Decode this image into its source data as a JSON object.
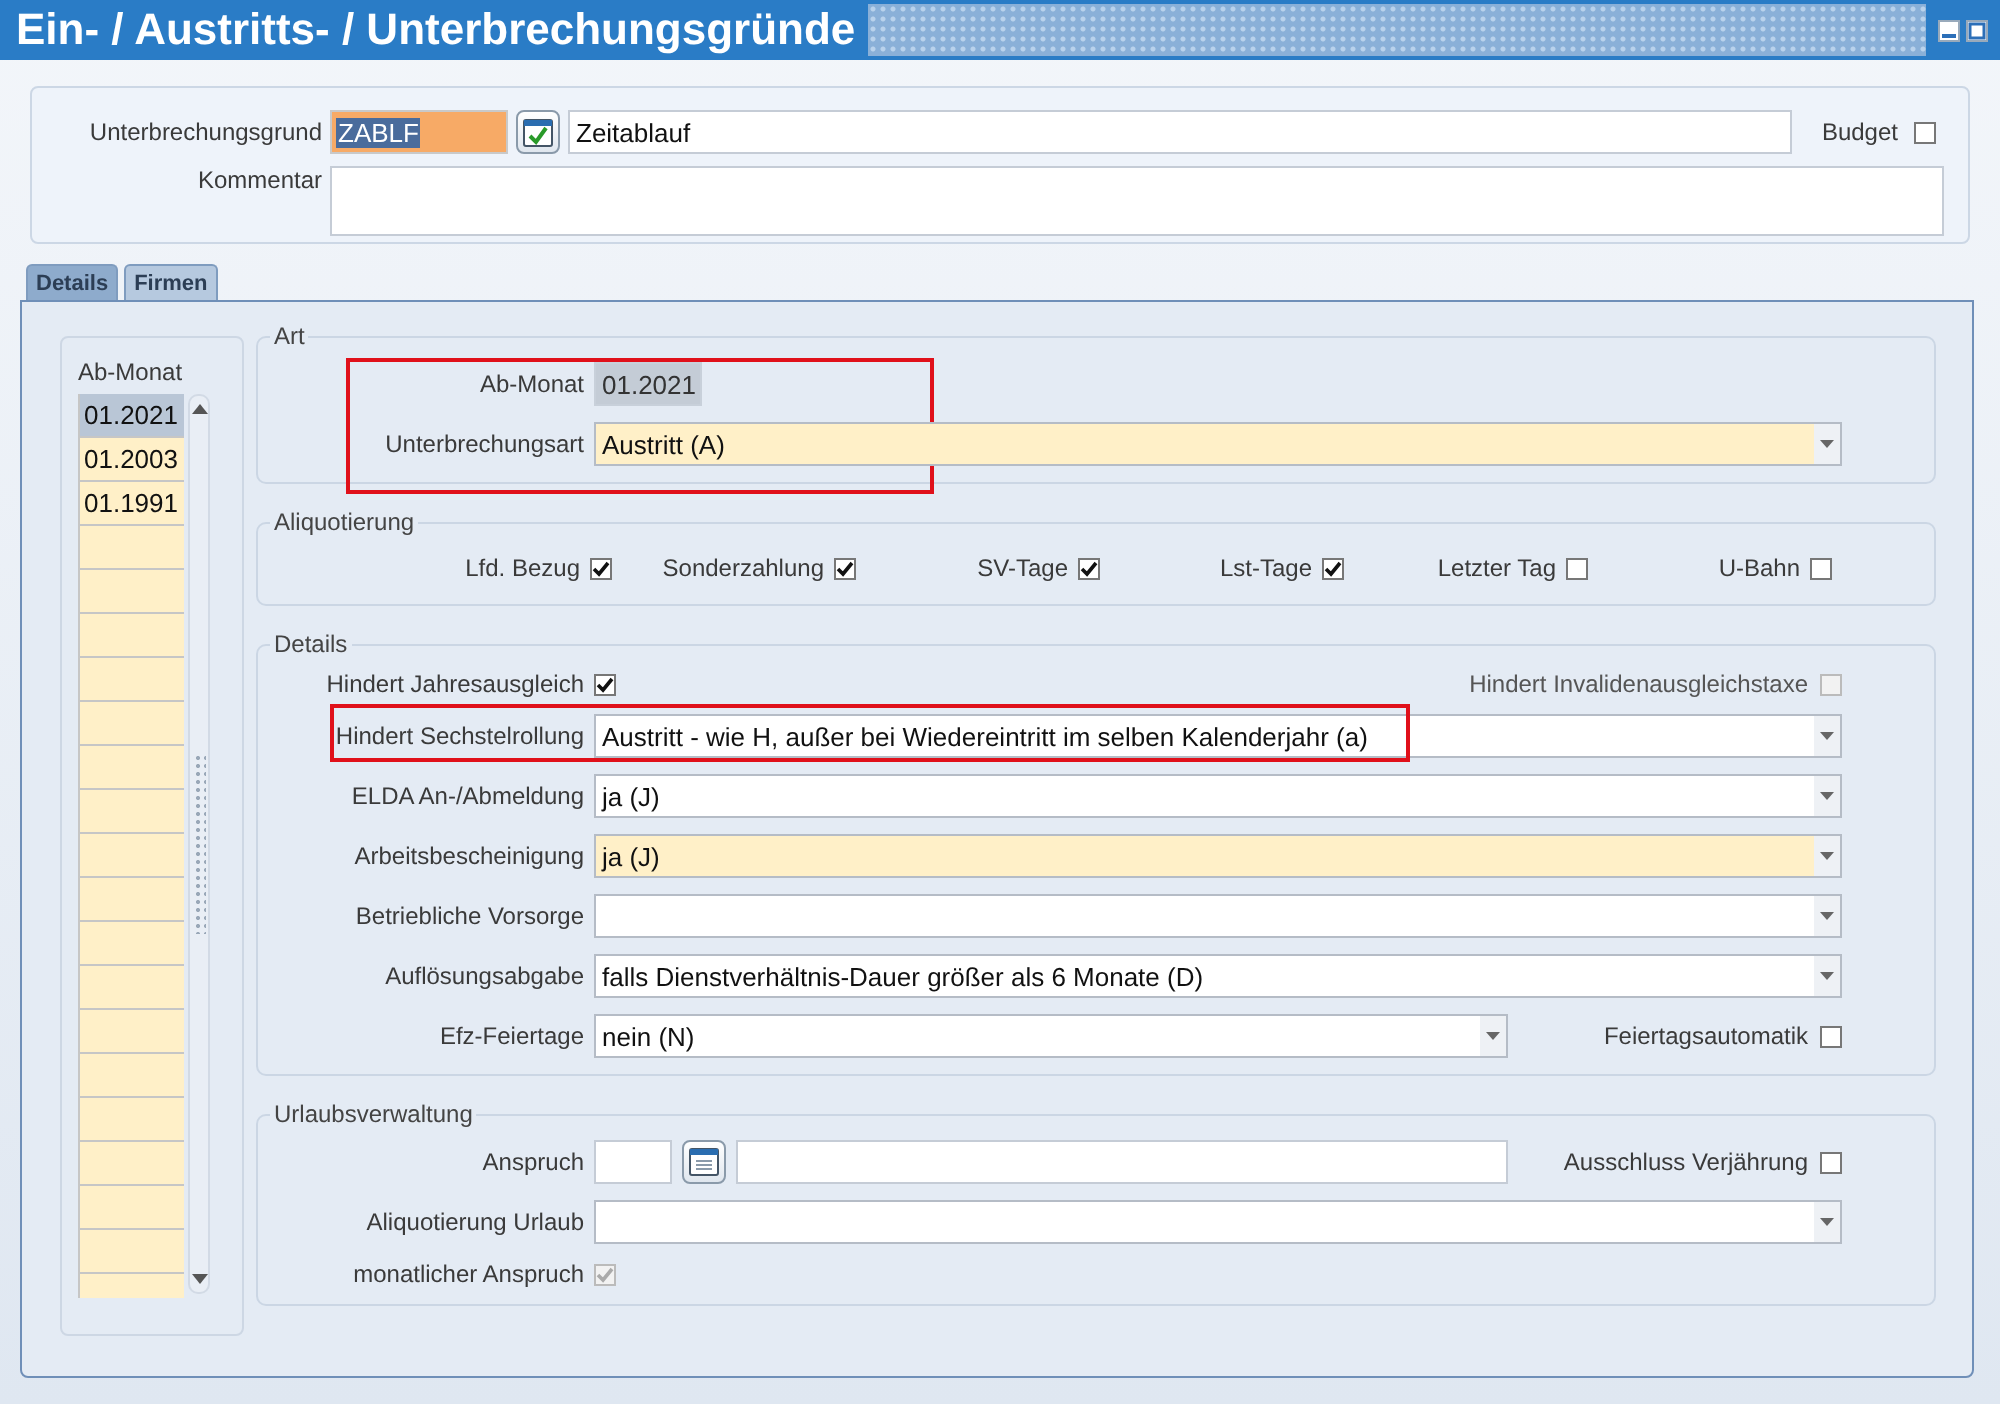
{
  "window": {
    "title": "Ein- / Austritts- / Unterbrechungsgründe"
  },
  "header": {
    "reason_label": "Unterbrechungsgrund",
    "reason_code": "ZABLF",
    "reason_text": "Zeitablauf",
    "budget": {
      "label": "Budget",
      "checked": false
    },
    "comment_label": "Kommentar"
  },
  "tabs": [
    {
      "label": "Details",
      "selected": true
    },
    {
      "label": "Firmen",
      "selected": false
    }
  ],
  "month_list": {
    "header": "Ab-Monat",
    "rows": [
      {
        "value": "01.2021",
        "selected": true
      },
      {
        "value": "01.2003",
        "selected": false
      },
      {
        "value": "01.1991",
        "selected": false
      }
    ]
  },
  "sections": [
    {
      "legend": "Art",
      "highlighted": true,
      "rows": [
        {
          "kind": "readonly",
          "label": "Ab-Monat",
          "value": "01.2021"
        },
        {
          "kind": "combo",
          "label": "Unterbrechungsart",
          "value": "Austritt (A)",
          "required": true,
          "highlighted": false
        }
      ]
    },
    {
      "legend": "Aliquotierung",
      "highlighted": false,
      "rows": [
        {
          "kind": "checks",
          "items": [
            {
              "label": "Lfd. Bezug",
              "checked": true
            },
            {
              "label": "Sonderzahlung",
              "checked": true
            },
            {
              "label": "SV-Tage",
              "checked": true
            },
            {
              "label": "Lst-Tage",
              "checked": true
            },
            {
              "label": "Letzter Tag",
              "checked": false
            },
            {
              "label": "U-Bahn",
              "checked": false
            }
          ]
        }
      ]
    },
    {
      "legend": "Details",
      "highlighted": false,
      "rows": [
        {
          "kind": "check",
          "label": "Hindert Jahresausgleich",
          "checked": true,
          "disabled": false,
          "side": {
            "label": "Hindert Invalidenausgleichstaxe",
            "checked": false,
            "disabled": true
          }
        },
        {
          "kind": "combo",
          "label": "Hindert Sechstelrollung",
          "value": "Austritt - wie H, außer bei Wiedereintritt im selben Kalenderjahr (a)",
          "required": false,
          "highlighted": true
        },
        {
          "kind": "combo",
          "label": "ELDA An-/Abmeldung",
          "value": "ja (J)",
          "required": false,
          "highlighted": false
        },
        {
          "kind": "combo",
          "label": "Arbeitsbescheinigung",
          "value": "ja (J)",
          "required": true,
          "highlighted": false
        },
        {
          "kind": "combo",
          "label": "Betriebliche Vorsorge",
          "required": false,
          "highlighted": false
        },
        {
          "kind": "combo",
          "label": "Auflösungsabgabe",
          "value": "falls Dienstverhältnis-Dauer größer als 6 Monate (D)",
          "required": false,
          "highlighted": false
        },
        {
          "kind": "combo",
          "label": "Efz-Feiertage",
          "value": "nein (N)",
          "required": false,
          "highlighted": false,
          "side": {
            "label": "Feiertagsautomatik",
            "checked": false,
            "disabled": false
          }
        }
      ]
    },
    {
      "legend": "Urlaubsverwaltung",
      "highlighted": false,
      "rows": [
        {
          "kind": "amount",
          "label": "Anspruch",
          "side": {
            "label": "Ausschluss Verjährung",
            "checked": false,
            "disabled": false
          }
        },
        {
          "kind": "combo",
          "label": "Aliquotierung Urlaub",
          "required": false,
          "highlighted": false
        },
        {
          "kind": "check",
          "label": "monatlicher Anspruch",
          "checked": true,
          "disabled": true
        }
      ]
    }
  ]
}
